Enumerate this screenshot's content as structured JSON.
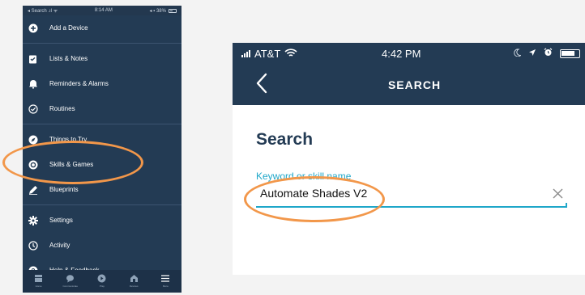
{
  "left_panel": {
    "status_bar": {
      "carrier": "◂ Search .ıl ᯤ",
      "time": "8:14 AM",
      "battery": "◂ ▪ 38%"
    },
    "menu_items": [
      {
        "label": "Add a Device",
        "icon": "plus-circle-icon"
      },
      {
        "label": "Lists & Notes",
        "icon": "clipboard-icon"
      },
      {
        "label": "Reminders & Alarms",
        "icon": "bell-icon"
      },
      {
        "label": "Routines",
        "icon": "checkmark-circle-icon"
      },
      {
        "label": "Things to Try",
        "icon": "compass-icon"
      },
      {
        "label": "Skills & Games",
        "icon": "skills-icon"
      },
      {
        "label": "Blueprints",
        "icon": "pencil-icon"
      },
      {
        "label": "Settings",
        "icon": "gear-icon"
      },
      {
        "label": "Activity",
        "icon": "clock-icon"
      },
      {
        "label": "Help & Feedback",
        "icon": "question-icon"
      }
    ],
    "bottom_nav": [
      {
        "label": "Home",
        "icon": "home-icon"
      },
      {
        "label": "Communicate",
        "icon": "chat-icon"
      },
      {
        "label": "Play",
        "icon": "play-icon"
      },
      {
        "label": "Devices",
        "icon": "devices-icon"
      },
      {
        "label": "More",
        "icon": "menu-icon"
      }
    ]
  },
  "right_panel": {
    "status_bar": {
      "carrier": "AT&T",
      "time": "4:42 PM"
    },
    "header_title": "SEARCH",
    "page_heading": "Search",
    "search_field": {
      "label": "Keyword or skill name",
      "value": "Automate Shades V2"
    }
  },
  "colors": {
    "nav_background": "#233b54",
    "accent": "#1fa7c9",
    "highlight": "#f2974a"
  }
}
